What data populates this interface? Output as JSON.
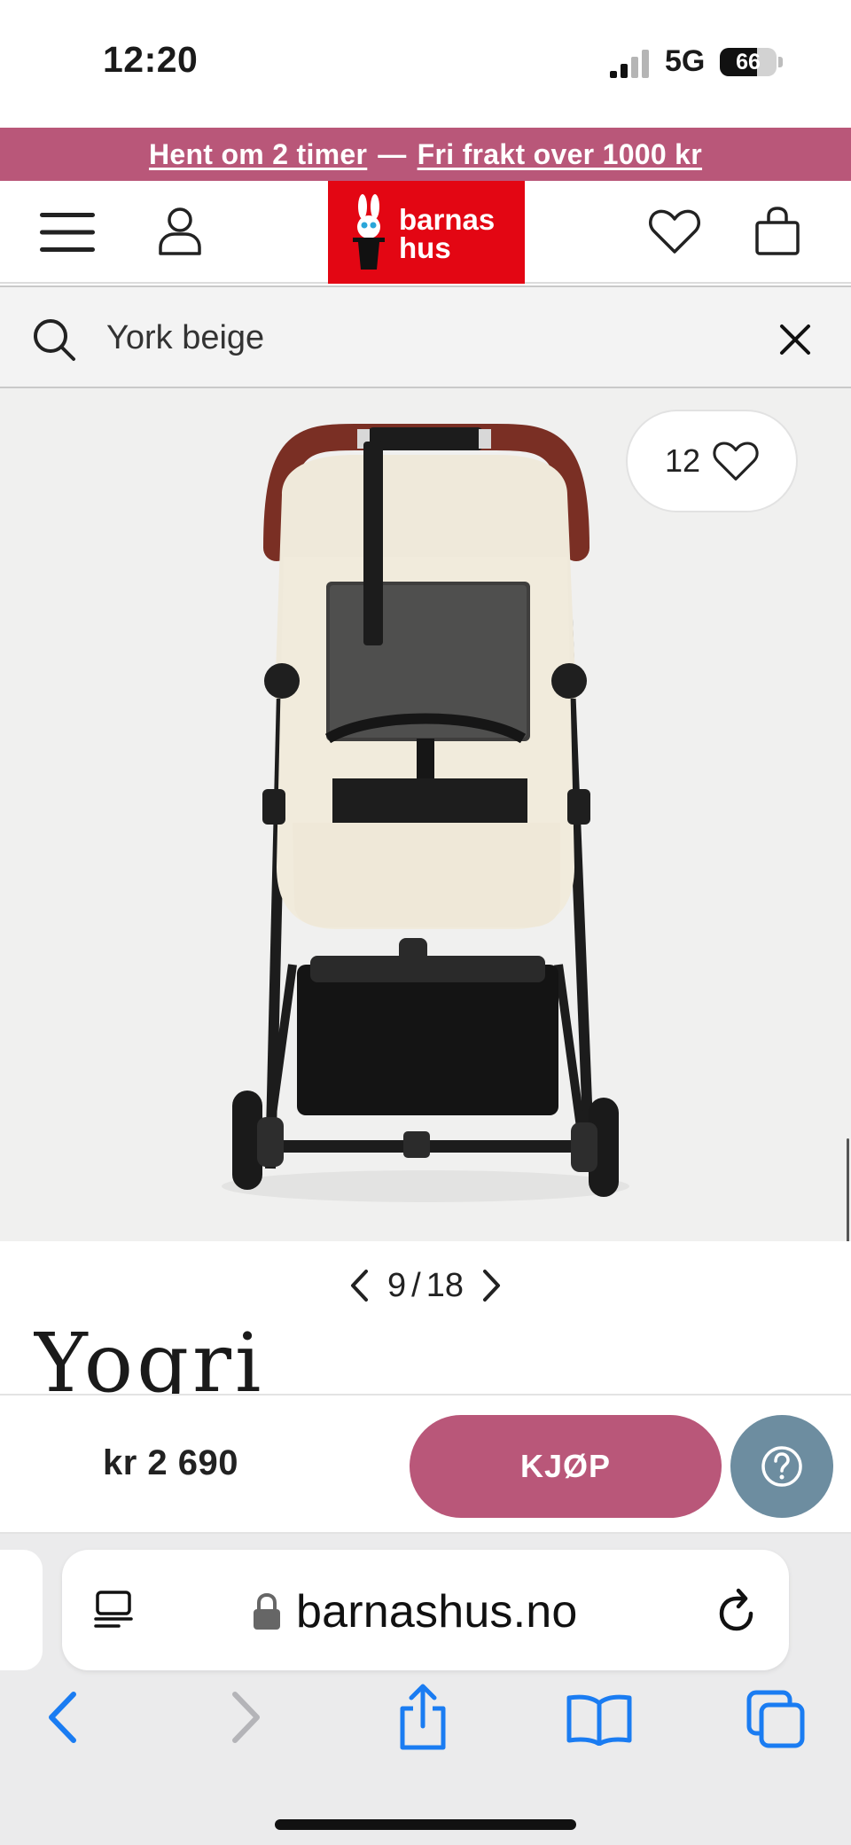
{
  "status_bar": {
    "time": "12:20",
    "network": "5G",
    "battery": "66",
    "battery_level": 0.66,
    "signal_bars_active": 2,
    "signal_bars_total": 4
  },
  "promo": {
    "part1": "Hent om 2 timer",
    "separator": "—",
    "part2": "Fri frakt over 1000 kr",
    "background": "#b95779"
  },
  "header": {
    "logo_line1": "barnas",
    "logo_line2": "hus",
    "logo_color": "#e30613",
    "icons": [
      "menu-icon",
      "account-icon",
      "heart-icon",
      "shopping-bag-icon"
    ]
  },
  "search": {
    "value": "York beige",
    "icons": [
      "search-icon",
      "close-icon"
    ]
  },
  "product": {
    "favorite_count": "12",
    "image_subject": "stroller"
  },
  "gallery_pager": {
    "current": "9",
    "separator": "/",
    "total": "18"
  },
  "brand": {
    "name": "Yogri"
  },
  "buy_bar": {
    "price": "kr 2 690",
    "buy_label": "KJØP",
    "accent": "#b95779",
    "help_color": "#6d8da0"
  },
  "browser": {
    "url": "barnashus.no",
    "icons": [
      "reader-icon",
      "lock-icon",
      "reload-icon",
      "back-icon",
      "forward-icon",
      "share-icon",
      "bookmarks-icon",
      "tabs-icon"
    ],
    "accent": "#1a7cf2"
  }
}
